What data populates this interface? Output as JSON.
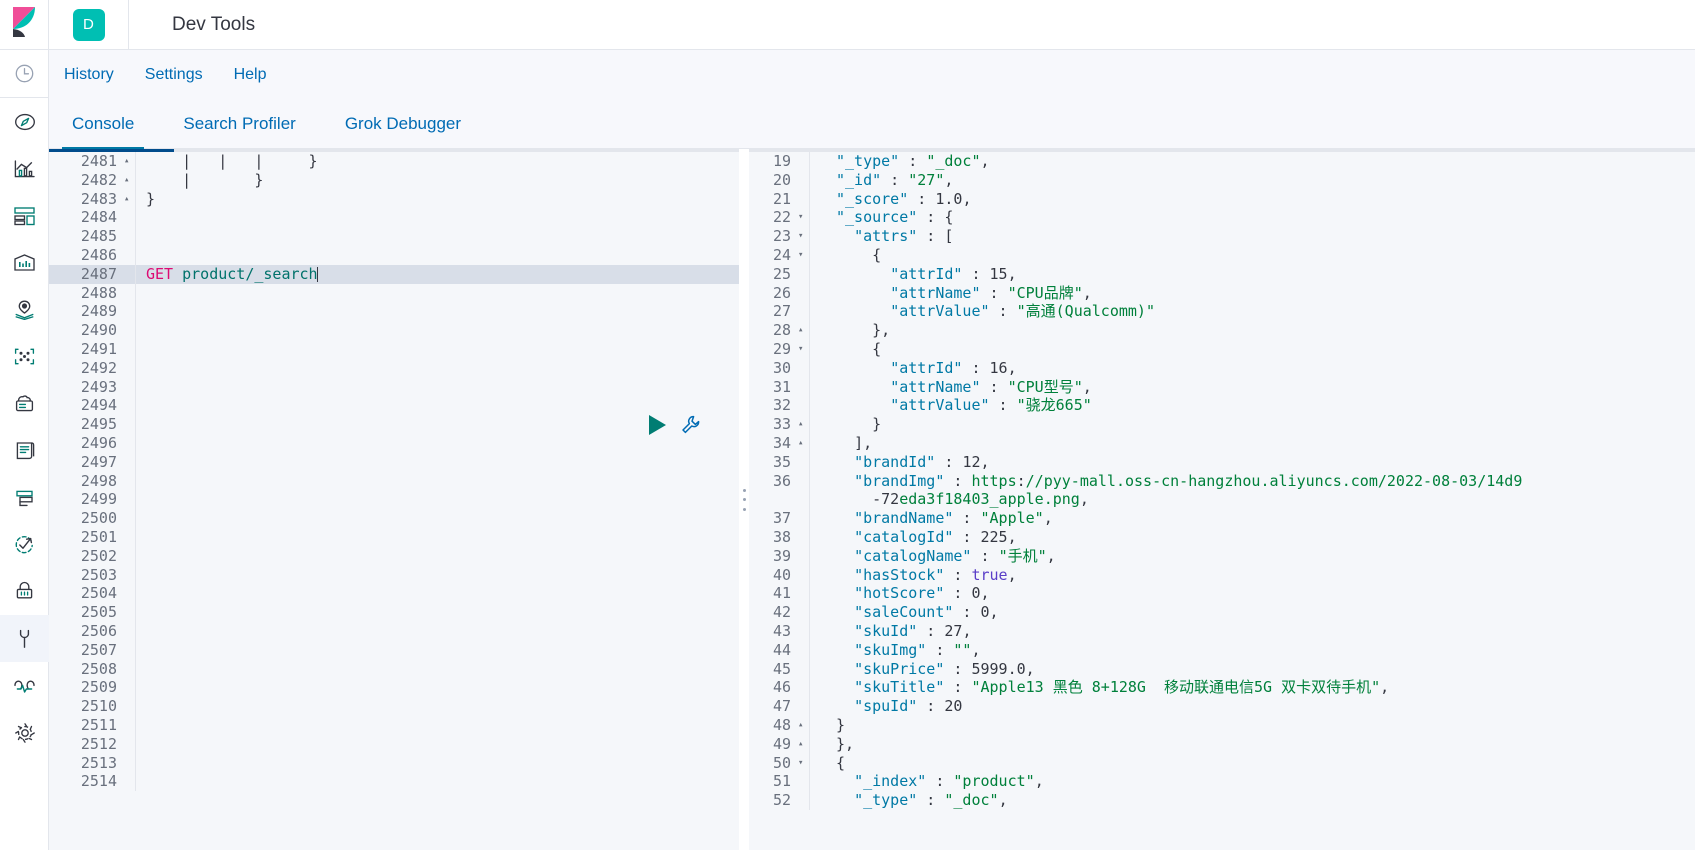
{
  "app": {
    "logo_icon": "kibana-logo",
    "badge_letter": "D",
    "title": "Dev Tools",
    "badge_color": "#00bfb3"
  },
  "rail": {
    "recent_icon": "clock-icon",
    "items": [
      {
        "name": "discover",
        "icon": "compass-icon",
        "selected": false
      },
      {
        "name": "visualize",
        "icon": "chart-icon",
        "selected": false
      },
      {
        "name": "dashboard",
        "icon": "dashboard-icon",
        "selected": false
      },
      {
        "name": "canvas",
        "icon": "canvas-icon",
        "selected": false
      },
      {
        "name": "maps",
        "icon": "map-marker-icon",
        "selected": false
      },
      {
        "name": "machine-learning",
        "icon": "ml-nodes-icon",
        "selected": false
      },
      {
        "name": "infrastructure",
        "icon": "infra-icon",
        "selected": false
      },
      {
        "name": "logs",
        "icon": "logs-icon",
        "selected": false
      },
      {
        "name": "apm",
        "icon": "apm-icon",
        "selected": false
      },
      {
        "name": "uptime",
        "icon": "uptime-icon",
        "selected": false
      },
      {
        "name": "security",
        "icon": "lock-icon",
        "selected": false
      },
      {
        "name": "dev-tools",
        "icon": "wrench-icon",
        "selected": true
      },
      {
        "name": "monitoring",
        "icon": "heartbeat-icon",
        "selected": false
      },
      {
        "name": "management",
        "icon": "gear-icon",
        "selected": false
      }
    ]
  },
  "menu": {
    "items": [
      "History",
      "Settings",
      "Help"
    ]
  },
  "tabs": [
    {
      "label": "Console",
      "active": true
    },
    {
      "label": "Search Profiler",
      "active": false
    },
    {
      "label": "Grok Debugger",
      "active": false
    }
  ],
  "request_editor": {
    "active_line": 2487,
    "method": "GET",
    "path": "product/_search",
    "play_icon": "play-icon",
    "wrench_icon": "wrench-icon",
    "lines": [
      {
        "n": 2481,
        "fold": "up",
        "text": "    |   |   |     }"
      },
      {
        "n": 2482,
        "fold": "up",
        "text": "    |       }"
      },
      {
        "n": 2483,
        "fold": "up",
        "text": "}"
      },
      {
        "n": 2484,
        "fold": "none",
        "text": ""
      },
      {
        "n": 2485,
        "fold": "none",
        "text": ""
      },
      {
        "n": 2486,
        "fold": "none",
        "text": ""
      },
      {
        "n": 2487,
        "fold": "none",
        "text": "GET product/_search"
      },
      {
        "n": 2488,
        "fold": "none",
        "text": ""
      },
      {
        "n": 2489,
        "fold": "none",
        "text": ""
      },
      {
        "n": 2490,
        "fold": "none",
        "text": ""
      },
      {
        "n": 2491,
        "fold": "none",
        "text": ""
      },
      {
        "n": 2492,
        "fold": "none",
        "text": ""
      },
      {
        "n": 2493,
        "fold": "none",
        "text": ""
      },
      {
        "n": 2494,
        "fold": "none",
        "text": ""
      },
      {
        "n": 2495,
        "fold": "none",
        "text": ""
      },
      {
        "n": 2496,
        "fold": "none",
        "text": ""
      },
      {
        "n": 2497,
        "fold": "none",
        "text": ""
      },
      {
        "n": 2498,
        "fold": "none",
        "text": ""
      },
      {
        "n": 2499,
        "fold": "none",
        "text": ""
      },
      {
        "n": 2500,
        "fold": "none",
        "text": ""
      },
      {
        "n": 2501,
        "fold": "none",
        "text": ""
      },
      {
        "n": 2502,
        "fold": "none",
        "text": ""
      },
      {
        "n": 2503,
        "fold": "none",
        "text": ""
      },
      {
        "n": 2504,
        "fold": "none",
        "text": ""
      },
      {
        "n": 2505,
        "fold": "none",
        "text": ""
      },
      {
        "n": 2506,
        "fold": "none",
        "text": ""
      },
      {
        "n": 2507,
        "fold": "none",
        "text": ""
      },
      {
        "n": 2508,
        "fold": "none",
        "text": ""
      },
      {
        "n": 2509,
        "fold": "none",
        "text": ""
      },
      {
        "n": 2510,
        "fold": "none",
        "text": ""
      },
      {
        "n": 2511,
        "fold": "none",
        "text": ""
      },
      {
        "n": 2512,
        "fold": "none",
        "text": ""
      },
      {
        "n": 2513,
        "fold": "none",
        "text": ""
      },
      {
        "n": 2514,
        "fold": "none",
        "text": ""
      }
    ]
  },
  "response_viewer": {
    "lines": [
      {
        "n": 19,
        "fold": "none",
        "clipped": true,
        "text": "\"_type\" : \"_doc\","
      },
      {
        "n": 20,
        "fold": "none",
        "text": "\"_id\" : \"27\","
      },
      {
        "n": 21,
        "fold": "none",
        "text": "\"_score\" : 1.0,"
      },
      {
        "n": 22,
        "fold": "down",
        "text": "\"_source\" : {"
      },
      {
        "n": 23,
        "fold": "down",
        "text": "  \"attrs\" : ["
      },
      {
        "n": 24,
        "fold": "down",
        "text": "    {"
      },
      {
        "n": 25,
        "fold": "none",
        "text": "      \"attrId\" : 15,"
      },
      {
        "n": 26,
        "fold": "none",
        "text": "      \"attrName\" : \"CPU品牌\","
      },
      {
        "n": 27,
        "fold": "none",
        "text": "      \"attrValue\" : \"高通(Qualcomm)\""
      },
      {
        "n": 28,
        "fold": "up",
        "text": "    },"
      },
      {
        "n": 29,
        "fold": "down",
        "text": "    {"
      },
      {
        "n": 30,
        "fold": "none",
        "text": "      \"attrId\" : 16,"
      },
      {
        "n": 31,
        "fold": "none",
        "text": "      \"attrName\" : \"CPU型号\","
      },
      {
        "n": 32,
        "fold": "none",
        "text": "      \"attrValue\" : \"骁龙665\""
      },
      {
        "n": 33,
        "fold": "up",
        "text": "    }"
      },
      {
        "n": 34,
        "fold": "up",
        "text": "  ],"
      },
      {
        "n": 35,
        "fold": "none",
        "text": "  \"brandId\" : 12,"
      },
      {
        "n": 36,
        "fold": "none",
        "text": "  \"brandImg\" : \"https://pyy-mall.oss-cn-hangzhou.aliyuncs.com/2022-08-03/14d9"
      },
      {
        "n": "",
        "fold": "none",
        "wrap": true,
        "text": "    -72eda3f18403_apple.png\","
      },
      {
        "n": 37,
        "fold": "none",
        "text": "  \"brandName\" : \"Apple\","
      },
      {
        "n": 38,
        "fold": "none",
        "text": "  \"catalogId\" : 225,"
      },
      {
        "n": 39,
        "fold": "none",
        "text": "  \"catalogName\" : \"手机\","
      },
      {
        "n": 40,
        "fold": "none",
        "text": "  \"hasStock\" : true,"
      },
      {
        "n": 41,
        "fold": "none",
        "text": "  \"hotScore\" : 0,"
      },
      {
        "n": 42,
        "fold": "none",
        "text": "  \"saleCount\" : 0,"
      },
      {
        "n": 43,
        "fold": "none",
        "text": "  \"skuId\" : 27,"
      },
      {
        "n": 44,
        "fold": "none",
        "text": "  \"skuImg\" : \"\","
      },
      {
        "n": 45,
        "fold": "none",
        "text": "  \"skuPrice\" : 5999.0,"
      },
      {
        "n": 46,
        "fold": "none",
        "text": "  \"skuTitle\" : \"Apple13 黑色 8+128G  移动联通电信5G 双卡双待手机\","
      },
      {
        "n": 47,
        "fold": "none",
        "text": "  \"spuId\" : 20"
      },
      {
        "n": 48,
        "fold": "up",
        "text": "}"
      },
      {
        "n": 49,
        "fold": "up",
        "text": "},"
      },
      {
        "n": 50,
        "fold": "down",
        "text": "{"
      },
      {
        "n": 51,
        "fold": "none",
        "text": "  \"_index\" : \"product\","
      },
      {
        "n": 52,
        "fold": "none",
        "clipped": true,
        "text": "  \"_type\" : \"_doc\","
      }
    ]
  },
  "colors": {
    "accent": "#006bb4",
    "teal": "#017d73",
    "method": "#dd0a73",
    "string": "#00803b",
    "key": "#0079a5",
    "bool": "#5a3ec8",
    "highlight_row": "#d8dee8"
  }
}
